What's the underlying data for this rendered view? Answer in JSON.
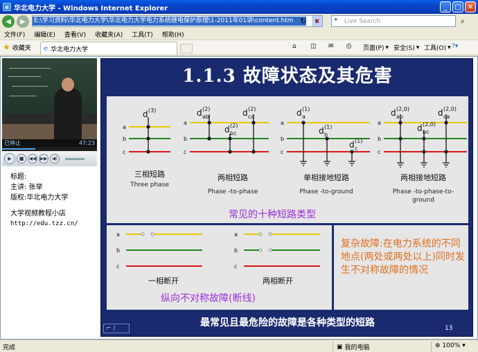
{
  "window": {
    "title": "华北电力大学 - Windows Internet Explorer",
    "controls": {
      "minimize": "_",
      "maximize": "□",
      "close": "✕"
    }
  },
  "address": {
    "url": "E:\\学习资料\\华北电力大学\\华北电力大学电力系统继电保护原理\\1-2011年01讲\\content.htm"
  },
  "search": {
    "placeholder": "Live Search"
  },
  "menu": [
    "文件(F)",
    "编辑(E)",
    "查看(V)",
    "收藏夹(A)",
    "工具(T)",
    "帮助(H)"
  ],
  "favorites": {
    "label": "收藏夹"
  },
  "tab": {
    "label": "华北电力大学"
  },
  "command_bar": {
    "page": "页面(P)",
    "safety": "安全(S)",
    "tools": "工具(O)"
  },
  "player": {
    "status": "已停止",
    "time": "47:23",
    "progress": 0.35
  },
  "info": {
    "title_label": "标题:",
    "speaker": "主讲: 张举",
    "copyright": "版权:华北电力大学",
    "site_name": "大学视频教程小店",
    "site_url": "http://edu.tzz.cn/"
  },
  "slide": {
    "title": "1.1.3  故障状态及其危害",
    "diagrams": [
      {
        "label_cn": "三相短路",
        "label_en": "Three phase",
        "marker": "d(3)"
      },
      {
        "label_cn": "两相短路",
        "label_en": "Phase -to-phase",
        "markers": [
          "d(2) ab",
          "d(2) bc",
          "d(2) ca"
        ]
      },
      {
        "label_cn": "单相接地短路",
        "label_en": "Phase -to-ground",
        "markers": [
          "d(1) a",
          "d(1) b",
          "d(1) c"
        ]
      },
      {
        "label_cn": "两相接地短路",
        "label_en": "Phase -to-phase-to-ground",
        "markers": [
          "d(2,0) ab",
          "d(2,0) bc",
          "d(2,0) ca"
        ]
      }
    ],
    "phases": [
      "a",
      "b",
      "c"
    ],
    "summary_purple": "常见的十种短路类型",
    "open_circuit": [
      {
        "label_cn": "一相断开"
      },
      {
        "label_cn": "两相断开"
      }
    ],
    "longitudinal_label": "纵向不对称故障(断线)",
    "complex_fault": "复杂故障:在电力系统的不同地点(两处或两处以上)同时发生不对称故障的情况",
    "bottom_note": "最常见且最危险的故障是各种类型的短路",
    "page_number": "13",
    "phase_colors": {
      "a": "#e8c800",
      "b": "#1a8a1a",
      "c": "#d81818"
    }
  },
  "status": {
    "left": "完成",
    "zone": "我的电脑",
    "zoom": "100%"
  }
}
